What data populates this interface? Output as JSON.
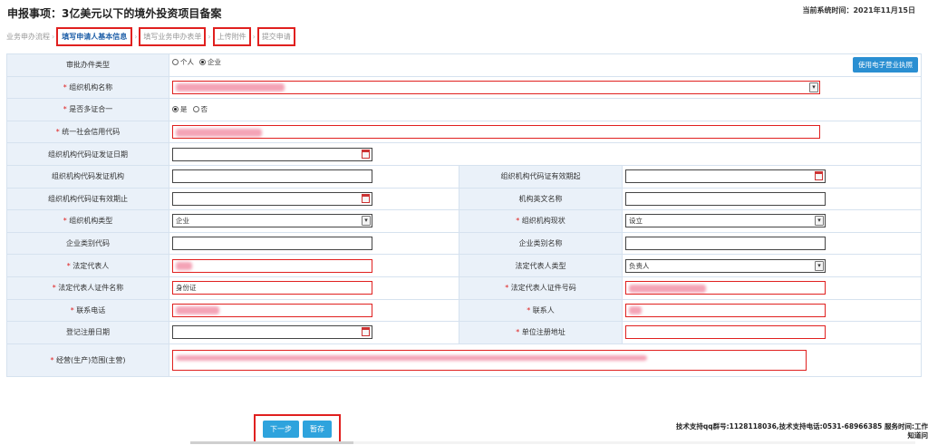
{
  "header": {
    "title": "申报事项：3亿美元以下的境外投资项目备案",
    "system_time": "当前系统时间：2021年11月15日"
  },
  "steps": [
    {
      "label": "业务申办流程"
    },
    {
      "label": "填写申请人基本信息"
    },
    {
      "label": "填写业务申办表单"
    },
    {
      "label": "上传附件"
    },
    {
      "label": "提交申请"
    }
  ],
  "form": {
    "approval_type_label": "审批办件类型",
    "approval_type_options": [
      "个人",
      "企业"
    ],
    "license_button": "使用电子营业执照",
    "org_name_label": "组织机构名称",
    "multi_cert_label": "是否多证合一",
    "multi_cert_options": [
      "是",
      "否"
    ],
    "credit_code_label": "统一社会信用代码",
    "org_code_issue_date_label": "组织机构代码证发证日期",
    "org_code_issuer_label": "组织机构代码发证机构",
    "org_code_valid_from_label": "组织机构代码证有效期起",
    "org_code_valid_to_label": "组织机构代码证有效期止",
    "org_english_name_label": "机构英文名称",
    "org_type_label": "组织机构类型",
    "org_type_value": "企业",
    "org_status_label": "组织机构现状",
    "org_status_value": "设立",
    "enterprise_code_label": "企业类别代码",
    "enterprise_name_label": "企业类别名称",
    "legal_rep_label": "法定代表人",
    "legal_rep_type_label": "法定代表人类型",
    "legal_rep_type_value": "负责人",
    "legal_rep_id_name_label": "法定代表人证件名称",
    "legal_rep_id_name_value": "身份证",
    "legal_rep_id_no_label": "法定代表人证件号码",
    "phone_label": "联系电话",
    "contact_label": "联系人",
    "reg_date_label": "登记注册日期",
    "reg_address_label": "单位注册地址",
    "business_scope_label": "经营(生产)范围(主营)"
  },
  "actions": {
    "next": "下一步",
    "save": "暂存"
  },
  "footer": {
    "line1": "技术支持qq群号:1128118036,技术支持电话:0531-68966385 服务时间:工作",
    "line2": "知道问"
  }
}
